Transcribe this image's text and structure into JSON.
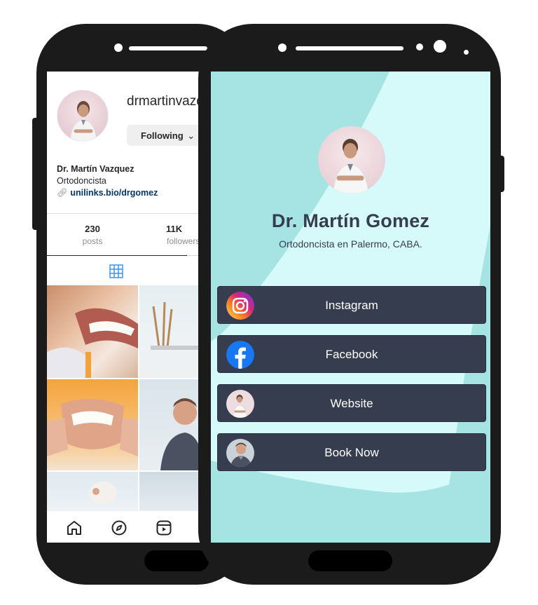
{
  "instagram_profile": {
    "username": "drmartinvazq",
    "follow_button": "Following",
    "follow_chevron": "⌄",
    "display_name": "Dr. Martín Vazquez",
    "bio": "Ortodoncista",
    "link": "unilinks.bio/drgomez",
    "stats": [
      {
        "value": "230",
        "label": "posts"
      },
      {
        "value": "11K",
        "label": "followers"
      }
    ],
    "nav_icons": [
      "home-icon",
      "explore-icon",
      "reels-icon"
    ]
  },
  "link_page": {
    "name": "Dr. Martín Gomez",
    "subtitle": "Ortodoncista en Palermo, CABA.",
    "buttons": [
      {
        "label": "Instagram",
        "icon": "instagram-icon"
      },
      {
        "label": "Facebook",
        "icon": "facebook-icon"
      },
      {
        "label": "Website",
        "icon": "doctor-photo-icon"
      },
      {
        "label": "Book Now",
        "icon": "person-photo-icon"
      }
    ],
    "colors": {
      "background": "#d6fafa",
      "shape": "#a6e4e4",
      "button": "#353d4f",
      "text": "#353d4f",
      "button_text": "#ffffff"
    }
  }
}
